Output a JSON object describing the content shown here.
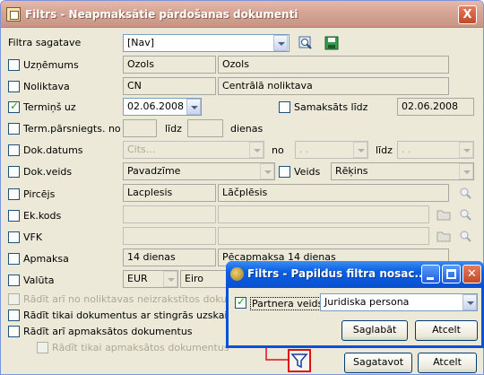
{
  "window": {
    "title": "Filtrs - Neapmaksātie pārdošanas dokumenti",
    "close_glyph": "X"
  },
  "template": {
    "label": "Filtra sagatave",
    "value": "[Nav]"
  },
  "rows": {
    "company": {
      "label": "Uzņēmums",
      "code": "Ozols",
      "name": "Ozols"
    },
    "branch": {
      "label": "Noliktava",
      "code": "CN",
      "name": "Centrālā noliktava"
    },
    "due": {
      "label": "Termiņš uz",
      "date": "02.06.2008",
      "paid_label": "Samaksāts līdz",
      "paid_date": "02.06.2008"
    },
    "term_exceeded": {
      "label": "Term.pārsniegts. no",
      "to_label": "līdz",
      "days_label": "dienas"
    },
    "doc_date": {
      "label": "Dok.datums",
      "value": "Cits...",
      "from_label": "no",
      "from_value": ". .",
      "to_label": "līdz",
      "to_value": ". ."
    },
    "doc_type": {
      "label": "Dok.veids",
      "value": "Pavadzīme",
      "kind_label": "Veids",
      "kind_value": "Rēķins"
    },
    "buyer": {
      "label": "Pircējs",
      "code": "Lacplesis",
      "name": "Lāčplēsis"
    },
    "ek_code": {
      "label": "Ek.kods"
    },
    "vfk": {
      "label": "VFK"
    },
    "payment": {
      "label": "Apmaksa",
      "code": "14 dienas",
      "name": "Pēcapmaksa 14 dienas"
    },
    "currency": {
      "label": "Valūta",
      "code": "EUR",
      "name": "Eiro"
    }
  },
  "options": {
    "show_unregistered": "Rādīt arī no noliktavas neizrakstītos dokumentus",
    "show_strict": "Rādīt tikai dokumentus ar stingrās uzskaites num",
    "show_paid": "Rādīt arī apmaksātos dokumentus",
    "show_only_paid": "Rādīt tikai apmaksātos dokumentus"
  },
  "buttons": {
    "save_template": "Sagatavot",
    "cancel": "Atcelt"
  },
  "popup": {
    "title": "Filtrs - Papildus filtra nosac...",
    "partner_label": "Partnera veids",
    "partner_value": "Juridiska persona",
    "save": "Saglabāt",
    "cancel": "Atcelt"
  }
}
